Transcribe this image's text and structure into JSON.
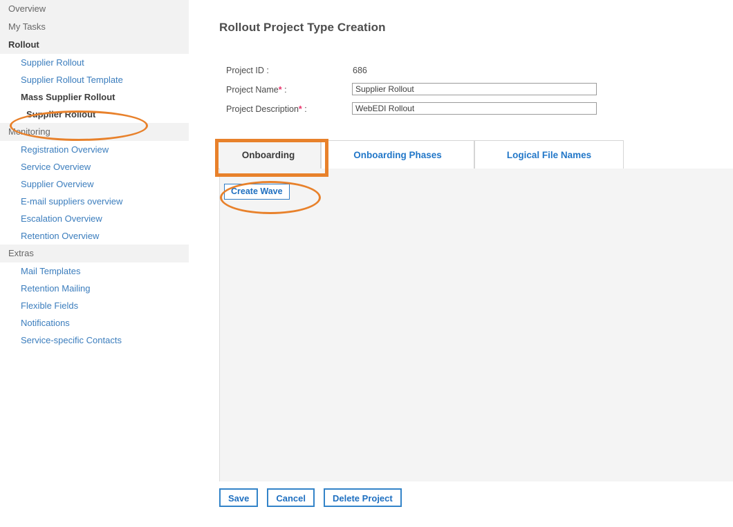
{
  "sidebar": {
    "groups": [
      {
        "name": "top",
        "header": null,
        "items": [
          {
            "label": "Overview",
            "style": "header"
          },
          {
            "label": "My Tasks",
            "style": "header"
          },
          {
            "label": "Rollout",
            "style": "header-bold"
          }
        ]
      },
      {
        "name": "rollout-links",
        "items": [
          {
            "label": "Supplier Rollout",
            "style": "link"
          },
          {
            "label": "Supplier Rollout Template",
            "style": "link"
          },
          {
            "label": "Mass Supplier Rollout",
            "style": "current"
          },
          {
            "label": "Supplier Rollout",
            "style": "current-sub"
          }
        ]
      },
      {
        "name": "monitoring",
        "header": "Monitoring",
        "items": [
          {
            "label": "Registration Overview",
            "style": "link"
          },
          {
            "label": "Service Overview",
            "style": "link"
          },
          {
            "label": "Supplier Overview",
            "style": "link"
          },
          {
            "label": "E-mail suppliers overview",
            "style": "link"
          },
          {
            "label": "Escalation Overview",
            "style": "link"
          },
          {
            "label": "Retention Overview",
            "style": "link"
          }
        ]
      },
      {
        "name": "extras",
        "header": "Extras",
        "items": [
          {
            "label": "Mail Templates",
            "style": "link"
          },
          {
            "label": "Retention Mailing",
            "style": "link"
          },
          {
            "label": "Flexible Fields",
            "style": "link"
          },
          {
            "label": "Notifications",
            "style": "link"
          },
          {
            "label": "Service-specific Contacts",
            "style": "link"
          }
        ]
      }
    ]
  },
  "main": {
    "page_title": "Rollout Project Type Creation",
    "form": {
      "project_id_label": "Project ID :",
      "project_id_value": "686",
      "project_name_label": "Project Name",
      "project_name_required_mark": "*",
      "project_name_label_suffix": " :",
      "project_name_value": "Supplier Rollout",
      "project_name_placeholder": "",
      "project_description_label": "Project Description",
      "project_description_required_mark": "*",
      "project_description_label_suffix": " :",
      "project_description_value": "WebEDI Rollout",
      "project_description_placeholder": ""
    },
    "tabs": [
      {
        "label": "Onboarding",
        "active": true
      },
      {
        "label": "Onboarding Phases",
        "active": false
      },
      {
        "label": "Logical File Names",
        "active": false
      }
    ],
    "panel": {
      "create_wave_label": "Create Wave"
    },
    "bottom_buttons": [
      {
        "label": "Save"
      },
      {
        "label": "Cancel"
      },
      {
        "label": "Delete Project"
      }
    ]
  },
  "annotations": {
    "color": "#e8812b",
    "marks": [
      {
        "name": "ellipse-around-supplier-rollout-nav",
        "shape": "ellipse"
      },
      {
        "name": "rectangle-around-onboarding-tab",
        "shape": "rectangle"
      },
      {
        "name": "ellipse-around-create-wave-button",
        "shape": "ellipse"
      }
    ]
  },
  "colors": {
    "link_blue": "#3b7dbd",
    "tab_blue": "#2277c8",
    "button_blue": "#3283c8",
    "required_pink": "#e8356d",
    "panel_gray": "#f4f4f4",
    "header_gray": "#f2f2f2"
  }
}
